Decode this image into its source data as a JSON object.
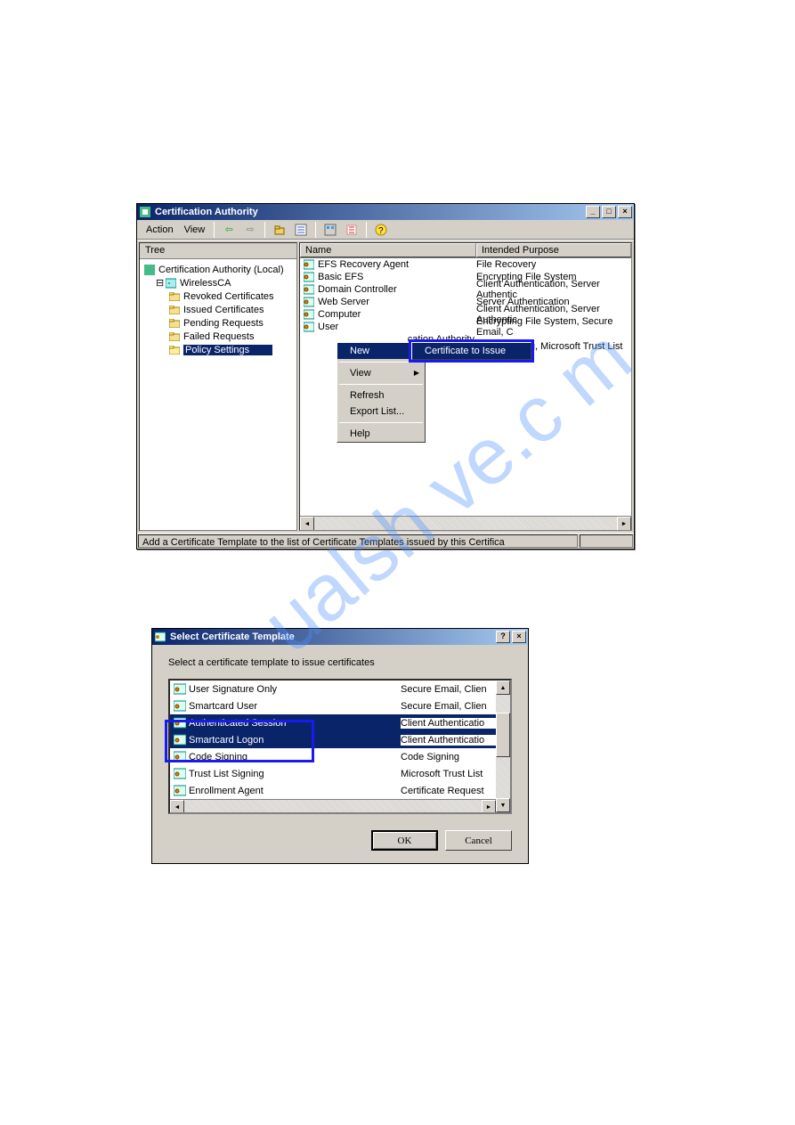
{
  "watermark_text": "ualsh ve.c m",
  "main_window": {
    "title": "Certification Authority",
    "menu": {
      "action": "Action",
      "view": "View"
    },
    "tree_tab": "Tree",
    "tree": {
      "root": "Certification Authority (Local)",
      "ca": "WirelessCA",
      "nodes": [
        "Revoked Certificates",
        "Issued Certificates",
        "Pending Requests",
        "Failed Requests",
        "Policy Settings"
      ]
    },
    "list_cols": {
      "name": "Name",
      "purpose": "Intended Purpose"
    },
    "list_rows": [
      {
        "name": "EFS Recovery Agent",
        "purpose": "File Recovery"
      },
      {
        "name": "Basic EFS",
        "purpose": "Encrypting File System"
      },
      {
        "name": "Domain Controller",
        "purpose": "Client Authentication, Server Authentic"
      },
      {
        "name": "Web Server",
        "purpose": "Server Authentication"
      },
      {
        "name": "Computer",
        "purpose": "Client Authentication, Server Authentic"
      },
      {
        "name": "User",
        "purpose": "Encrypting File System, Secure Email, C"
      },
      {
        "name_tail": "cation Authority",
        "purpose": ""
      },
      {
        "name": "",
        "purpose": "Code Signing, Microsoft Trust List Signi"
      }
    ],
    "context_menu": {
      "new": "New",
      "view": "View",
      "refresh": "Refresh",
      "export": "Export List...",
      "help": "Help",
      "submenu_cert": "Certificate to Issue"
    },
    "status": "Add a Certificate Template to the list of Certificate Templates issued by this Certifica"
  },
  "dialog": {
    "title": "Select Certificate Template",
    "prompt": "Select a certificate template to issue certificates",
    "rows": [
      {
        "name": "User Signature Only",
        "purpose": "Secure Email, Clien"
      },
      {
        "name": "Smartcard User",
        "purpose": "Secure Email, Clien"
      },
      {
        "name": "Authenticated Session",
        "purpose": "Client Authenticatio"
      },
      {
        "name": "Smartcard Logon",
        "purpose": "Client Authenticatio"
      },
      {
        "name": "Code Signing",
        "purpose": "Code Signing"
      },
      {
        "name": "Trust List Signing",
        "purpose": "Microsoft Trust List"
      },
      {
        "name": "Enrollment Agent",
        "purpose": "Certificate Request"
      }
    ],
    "ok": "OK",
    "cancel": "Cancel"
  }
}
